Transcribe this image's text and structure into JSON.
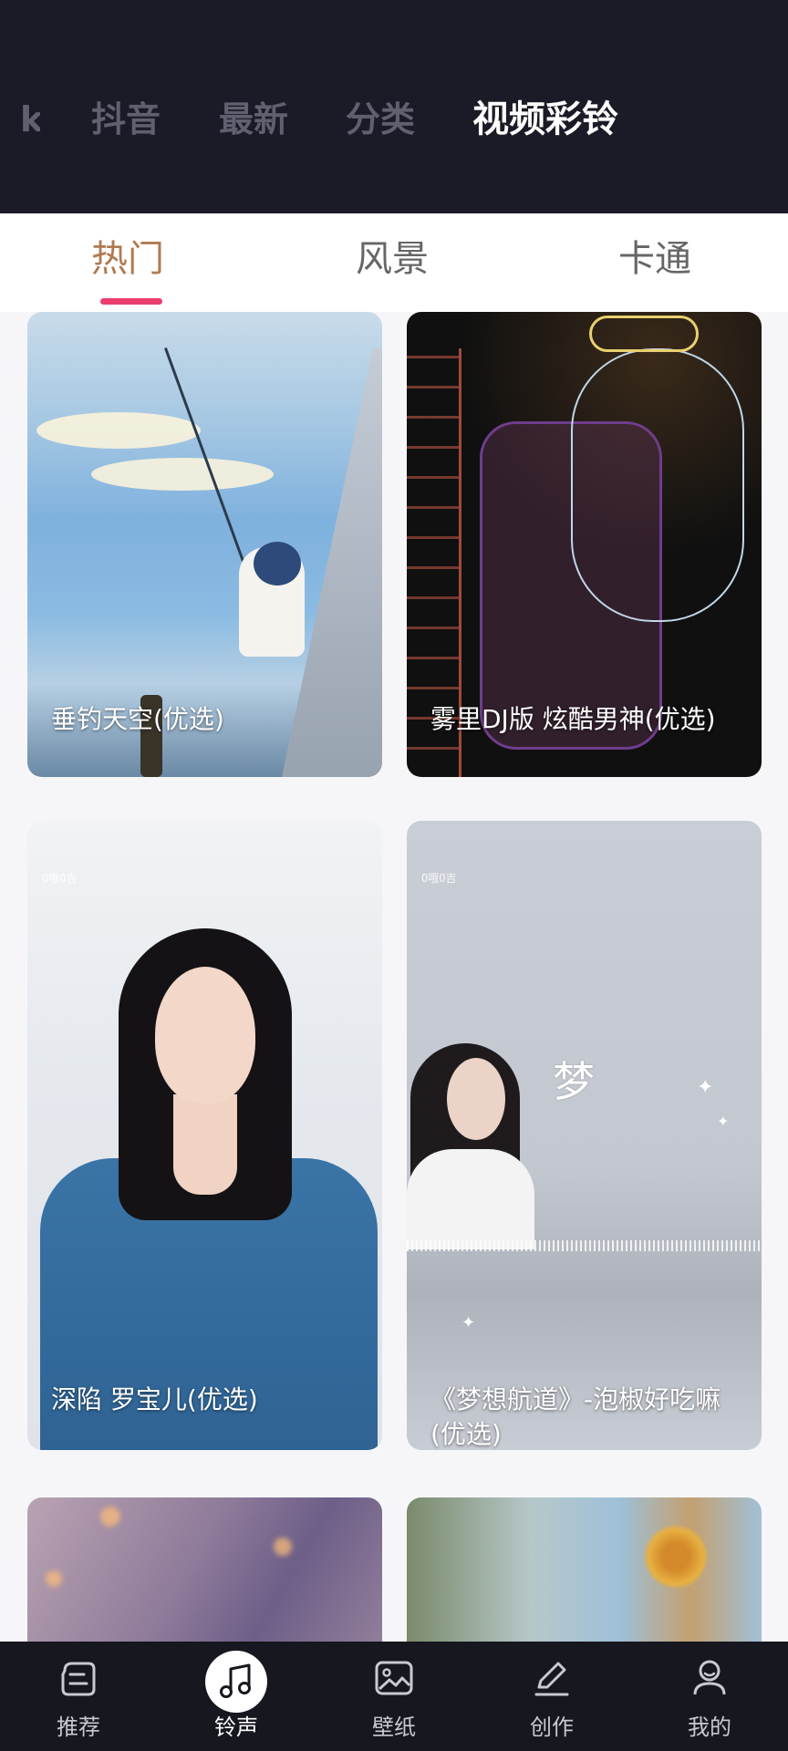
{
  "top_tabs": [
    {
      "label": "k"
    },
    {
      "label": "抖音"
    },
    {
      "label": "最新"
    },
    {
      "label": "分类"
    },
    {
      "label": "视频彩铃"
    }
  ],
  "sub_tabs": [
    {
      "label": "热门"
    },
    {
      "label": "风景"
    },
    {
      "label": "卡通"
    }
  ],
  "cards": [
    {
      "title": "垂钓天空(优选)"
    },
    {
      "title": "雾里DJ版 炫酷男神(优选)"
    },
    {
      "title": "深陷 罗宝儿(优选)",
      "watermark": "O哦O吉"
    },
    {
      "title": "《梦想航道》-泡椒好吃嘛(优选)",
      "watermark": "O哦O吉",
      "script": "梦"
    },
    {
      "title": ""
    },
    {
      "title": ""
    }
  ],
  "bottom_nav": [
    {
      "label": "推荐",
      "icon": "recommend-icon"
    },
    {
      "label": "铃声",
      "icon": "music-note-icon"
    },
    {
      "label": "壁纸",
      "icon": "wallpaper-icon"
    },
    {
      "label": "创作",
      "icon": "pen-icon"
    },
    {
      "label": "我的",
      "icon": "user-icon"
    }
  ],
  "colors": {
    "header_bg": "#1a1b26",
    "active_sub_tab": "#b07a50",
    "underline": "#ea3d6c",
    "nav_bg": "#16171f"
  }
}
